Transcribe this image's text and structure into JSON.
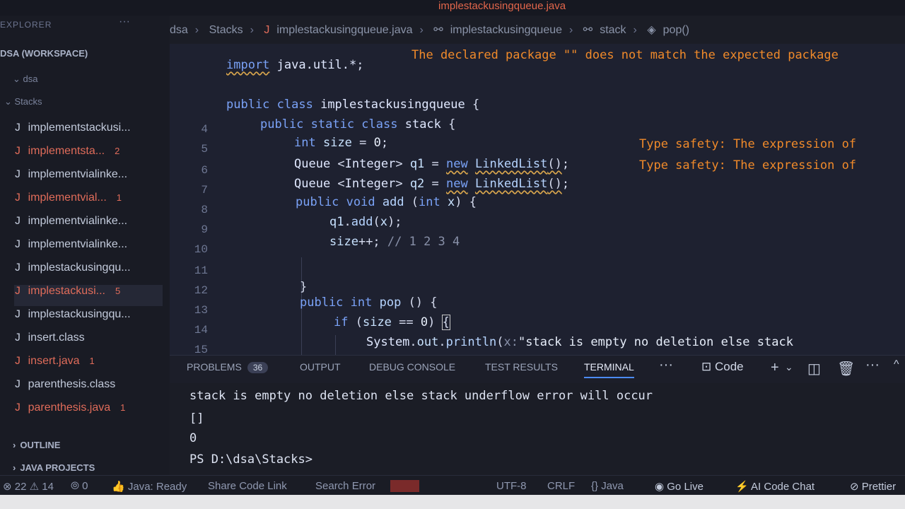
{
  "window": {
    "title": "implestackusingqueue.java"
  },
  "sidebar": {
    "header": "EXPLORER",
    "workspace": "DSA (WORKSPACE)",
    "tree": [
      {
        "label": "dsa"
      },
      {
        "label": "Stacks"
      }
    ],
    "files": [
      {
        "name": "implementstackusi...",
        "badge": "",
        "error": false
      },
      {
        "name": "implementsta...",
        "badge": "2",
        "error": true
      },
      {
        "name": "implementvialinke...",
        "badge": "",
        "error": false
      },
      {
        "name": "implementvial...",
        "badge": "1",
        "error": true
      },
      {
        "name": "implementvialinke...",
        "badge": "",
        "error": false
      },
      {
        "name": "implementvialinke...",
        "badge": "",
        "error": false
      },
      {
        "name": "implestackusingqu...",
        "badge": "",
        "error": false
      },
      {
        "name": "implestackusi...",
        "badge": "5",
        "error": true
      },
      {
        "name": "implestackusingqu...",
        "badge": "",
        "error": false
      },
      {
        "name": "insert.class",
        "badge": "",
        "error": false
      },
      {
        "name": "insert.java",
        "badge": "1",
        "error": true
      },
      {
        "name": "parenthesis.class",
        "badge": "",
        "error": false
      },
      {
        "name": "parenthesis.java",
        "badge": "1",
        "error": true
      }
    ],
    "outline": "OUTLINE",
    "java_projects": "JAVA PROJECTS"
  },
  "breadcrumb": [
    "dsa",
    "Stacks",
    "implestackusingqueue.java",
    "implestackusingqueue",
    "stack",
    "pop()"
  ],
  "editor": {
    "line_numbers": [
      "4",
      "5",
      "6",
      "7",
      "8",
      "9",
      "10",
      "11",
      "12",
      "13",
      "14",
      "15"
    ],
    "diagnostics": {
      "package": "The declared package \"\" does not match the expected package",
      "type_safety_1": "Type safety: The expression of",
      "type_safety_2": "Type safety: The expression of"
    }
  },
  "panel": {
    "tabs": [
      "PROBLEMS",
      "OUTPUT",
      "DEBUG CONSOLE",
      "TEST RESULTS",
      "TERMINAL"
    ],
    "problems_count": "36",
    "active_tab": "TERMINAL",
    "shell_label": "Code"
  },
  "terminal": {
    "lines": [
      "stack is empty no deletion else stack underflow error will occur",
      "[]",
      "0",
      "PS D:\\dsa\\Stacks>"
    ]
  },
  "statusbar": {
    "errors": "22",
    "warnings": "14",
    "ports": "0",
    "java": "Java: Ready",
    "share": "Share Code Link",
    "search": "Search Error",
    "encoding": "UTF-8",
    "eol": "CRLF",
    "language": "Java",
    "golive": "Go Live",
    "ai": "AI Code Chat",
    "prettier": "Prettier"
  }
}
